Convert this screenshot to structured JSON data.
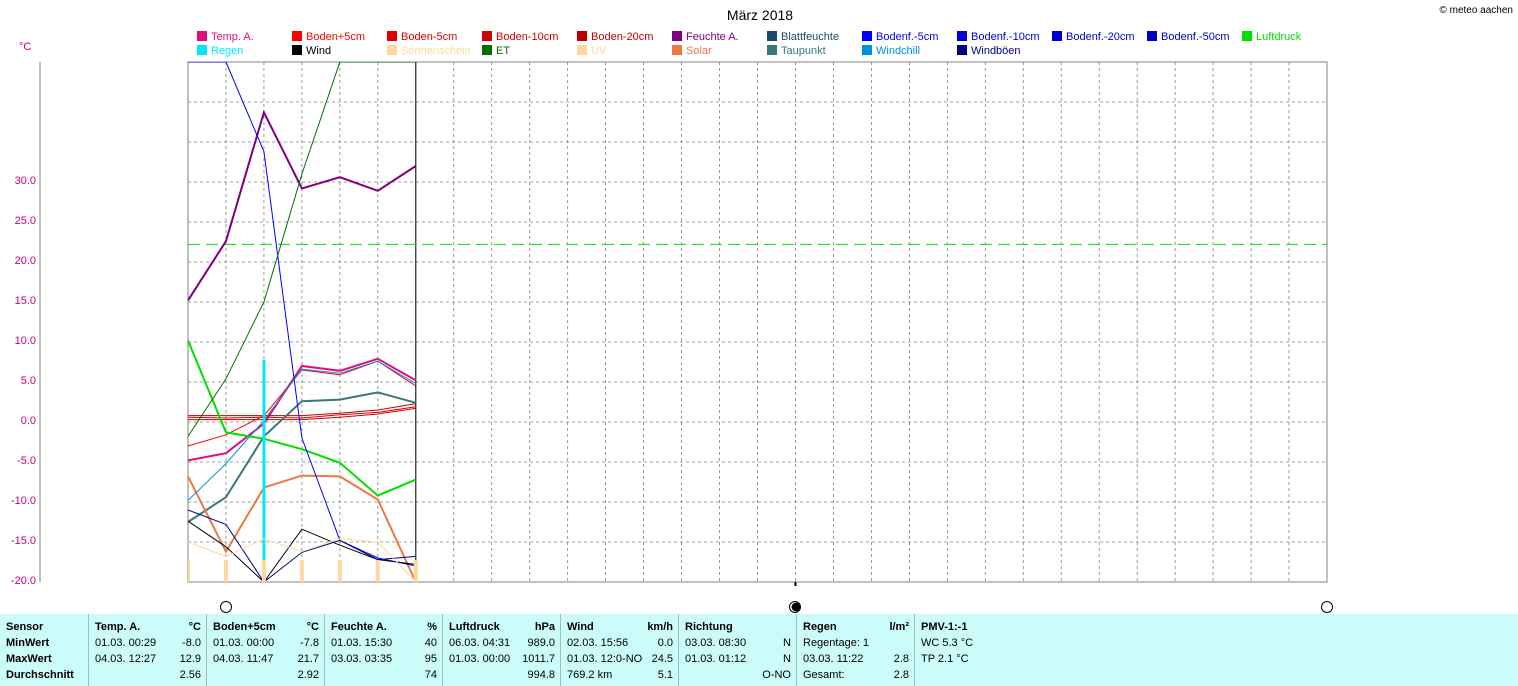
{
  "title": "März 2018",
  "copyright": "© meteo aachen",
  "unit": "°C",
  "legend": [
    {
      "name": "Temp. A.",
      "color": "#e0107a"
    },
    {
      "name": "Boden+5cm",
      "color": "#ff0000"
    },
    {
      "name": "Boden-5cm",
      "color": "#e00000"
    },
    {
      "name": "Boden-10cm",
      "color": "#d00000"
    },
    {
      "name": "Boden-20cm",
      "color": "#c00000"
    },
    {
      "name": "Feuchte A.",
      "color": "#800080"
    },
    {
      "name": "Blattfeuchte",
      "color": "#1a4a6a"
    },
    {
      "name": "Bodenf.-5cm",
      "color": "#0000ff"
    },
    {
      "name": "Bodenf.-10cm",
      "color": "#0000e0"
    },
    {
      "name": "Bodenf.-20cm",
      "color": "#0000d0"
    },
    {
      "name": "Bodenf.-50cm",
      "color": "#0000c0"
    },
    {
      "name": "Luftdruck",
      "color": "#00e000"
    },
    {
      "name": "Regen",
      "color": "#00e8f8"
    },
    {
      "name": "Wind",
      "color": "#000000"
    },
    {
      "name": "Sonnenschein",
      "color": "#ffd8a0"
    },
    {
      "name": "ET",
      "color": "#007000"
    },
    {
      "name": "UV",
      "color": "#ffd8a0"
    },
    {
      "name": "Solar",
      "color": "#f07840"
    },
    {
      "name": "Taupunkt",
      "color": "#3a7878"
    },
    {
      "name": "Windchill",
      "color": "#0090e0"
    },
    {
      "name": "Windböen",
      "color": "#000080"
    }
  ],
  "chart_data": {
    "type": "line",
    "ylabel": "°C",
    "ylim": [
      -20,
      45
    ],
    "yticks": [
      "30.0",
      "25.0",
      "20.0",
      "15.0",
      "10.0",
      "5.0",
      "0.0",
      "-5.0",
      "-10.0",
      "-15.0",
      "-20.0"
    ],
    "xlim": [
      1,
      31
    ],
    "x": [
      1,
      2,
      3,
      4,
      5,
      6,
      7
    ],
    "luftdruck_reference": 22.2,
    "series": [
      {
        "name": "Feuchte A.",
        "color": "#800080",
        "values": [
          15.2,
          22.6,
          38.7,
          29.2,
          30.6,
          28.9,
          32.0
        ]
      },
      {
        "name": "Temp. A.",
        "color": "#e0107a",
        "values": [
          -4.8,
          -3.9,
          -0.2,
          7.0,
          6.4,
          7.9,
          5.2
        ]
      },
      {
        "name": "Boden+5cm",
        "color": "#ff0000",
        "values": [
          -3.0,
          -1.6,
          0.8,
          6.5,
          5.9,
          7.6,
          4.5
        ]
      },
      {
        "name": "Boden-5cm",
        "color": "#e00000",
        "values": [
          0.6,
          0.5,
          0.6,
          0.5,
          0.9,
          1.2,
          1.9
        ]
      },
      {
        "name": "Boden-10cm",
        "color": "#d00000",
        "values": [
          0.3,
          0.3,
          0.3,
          0.3,
          0.6,
          1.0,
          1.7
        ]
      },
      {
        "name": "Boden-20cm",
        "color": "#c00000",
        "values": [
          0.8,
          0.8,
          0.8,
          0.8,
          1.1,
          1.5,
          2.3
        ]
      },
      {
        "name": "Taupunkt",
        "color": "#3a7878",
        "values": [
          -12.5,
          -9.4,
          -1.8,
          2.6,
          2.8,
          3.7,
          2.4
        ]
      },
      {
        "name": "Luftdruck",
        "color": "#00e000",
        "values": [
          10.2,
          -1.3,
          -2.1,
          -3.4,
          -5.1,
          -9.2,
          -7.2
        ]
      },
      {
        "name": "Solar",
        "color": "#f07840",
        "values": [
          -6.8,
          -16.2,
          -8.2,
          -6.7,
          -6.8,
          -9.7,
          -20.0
        ]
      },
      {
        "name": "Bodenf.-5cm",
        "color": "#0000ff",
        "values": [
          45.0,
          45.0,
          33.8,
          -2.0,
          -14.8,
          -17.0,
          -18.0
        ]
      },
      {
        "name": "Windchill",
        "color": "#0090e0",
        "values": [
          -9.8,
          -5.2,
          0.2,
          6.6,
          6.1,
          7.6,
          4.8
        ]
      },
      {
        "name": "Regen",
        "color": "#00e8f8",
        "values": [
          0,
          0,
          7.8,
          0,
          0,
          0,
          0
        ]
      },
      {
        "name": "ET",
        "color": "#007000",
        "values": [
          -1.8,
          5.4,
          15.0,
          31.0,
          45.0,
          45.0,
          45.0
        ]
      },
      {
        "name": "Wind",
        "color": "#000000",
        "values": [
          -12.4,
          -15.6,
          -20.0,
          -13.4,
          -15.4,
          -17.2,
          -17.8
        ]
      },
      {
        "name": "Windböen",
        "color": "#000080",
        "values": [
          -11.0,
          -12.8,
          -20.0,
          -16.3,
          -14.8,
          -17.2,
          -16.8
        ]
      },
      {
        "name": "Sonnenschein",
        "color": "#ffd8a0",
        "values": [
          -15.0,
          -16.8,
          -14.6,
          -16.2,
          -14.6,
          -15.0,
          -20.0
        ]
      }
    ],
    "moon_phases": [
      {
        "day": 2,
        "phase": "full"
      },
      {
        "day": 17,
        "phase": "new"
      },
      {
        "day": 31,
        "phase": "full"
      }
    ]
  },
  "table": {
    "row_labels": [
      "Sensor",
      "MinWert",
      "MaxWert",
      "Durchschnitt"
    ],
    "columns": [
      {
        "header": "Temp. A.",
        "unit": "°C",
        "min_time": "01.03.  00:29",
        "min": "-8.0",
        "max_time": "04.03.  12:27",
        "max": "12.9",
        "avg": "2.56"
      },
      {
        "header": "Boden+5cm",
        "unit": "°C",
        "min_time": "01.03.  00:00",
        "min": "-7.8",
        "max_time": "04.03.  11:47",
        "max": "21.7",
        "avg": "2.92"
      },
      {
        "header": "Feuchte A.",
        "unit": "%",
        "min_time": "01.03.  15:30",
        "min": "40",
        "max_time": "03.03.  03:35",
        "max": "95",
        "avg": "74"
      },
      {
        "header": "Luftdruck",
        "unit": "hPa",
        "min_time": "06.03.  04:31",
        "min": "989.0",
        "max_time": "01.03.  00:00",
        "max": "1011.7",
        "avg": "994.8"
      },
      {
        "header": "Wind",
        "unit": "km/h",
        "min_time": "02.03.  15:56",
        "min": "0.0",
        "max_time": "01.03.  12:0-NO",
        "max": "24.5",
        "avg_left": "769.2 km",
        "avg": "5.1"
      },
      {
        "header": "Richtung",
        "unit": "",
        "min_time": "03.03.  08:30",
        "min": "N",
        "max_time": "01.03.  01:12",
        "max": "N",
        "avg": "O-NO"
      },
      {
        "header": "Regen",
        "unit": "l/m²",
        "min_time": "Regentage: 1",
        "min": "",
        "max_time": "03.03.  11:22",
        "max": "2.8",
        "avg_left": "Gesamt:",
        "avg": "2.8"
      },
      {
        "header": "PMV-1:-1",
        "unit": "",
        "min_time": "WC 5.3 °C",
        "min": "",
        "max_time": "TP 2.1 °C",
        "max": "",
        "avg": ""
      }
    ]
  }
}
